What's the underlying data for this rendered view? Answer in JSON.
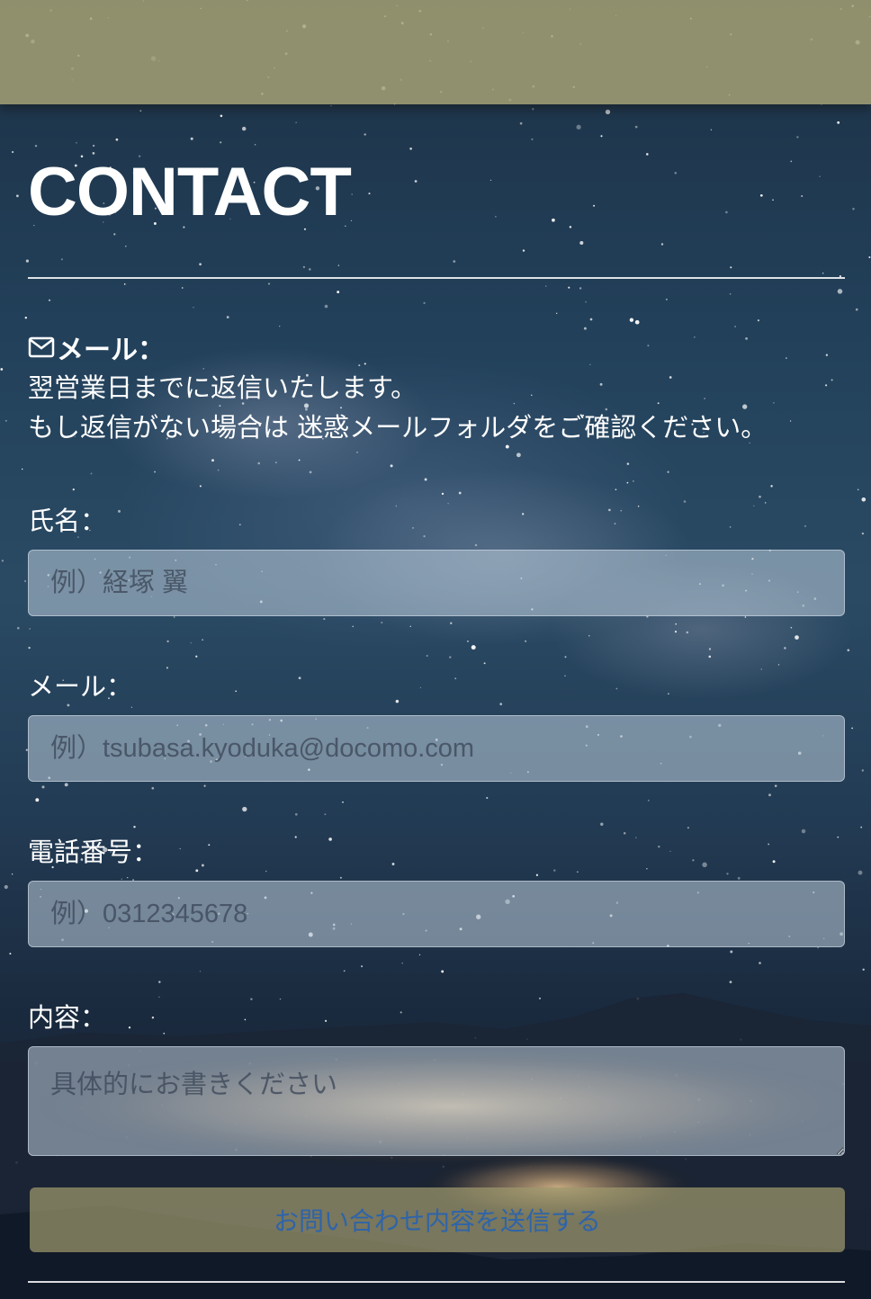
{
  "page": {
    "title": "CONTACT"
  },
  "mail_info": {
    "heading": "メール：",
    "icon": "envelope-icon",
    "line1": "翌営業日までに返信いたします。",
    "line2": "もし返信がない場合は 迷惑メールフォルダをご確認ください。"
  },
  "form": {
    "name": {
      "label": "氏名：",
      "placeholder": "例）経塚 翼"
    },
    "email": {
      "label": "メール：",
      "placeholder": "例）tsubasa.kyoduka@docomo.com"
    },
    "phone": {
      "label": "電話番号：",
      "placeholder": "例）0312345678"
    },
    "message": {
      "label": "内容：",
      "placeholder": "具体的にお書きください"
    },
    "submit_label": "お問い合わせ内容を送信する"
  },
  "colors": {
    "band": "#aaa576",
    "button": "#9e986e",
    "button_text": "#2f64a8",
    "field_bg": "#becdd8"
  }
}
